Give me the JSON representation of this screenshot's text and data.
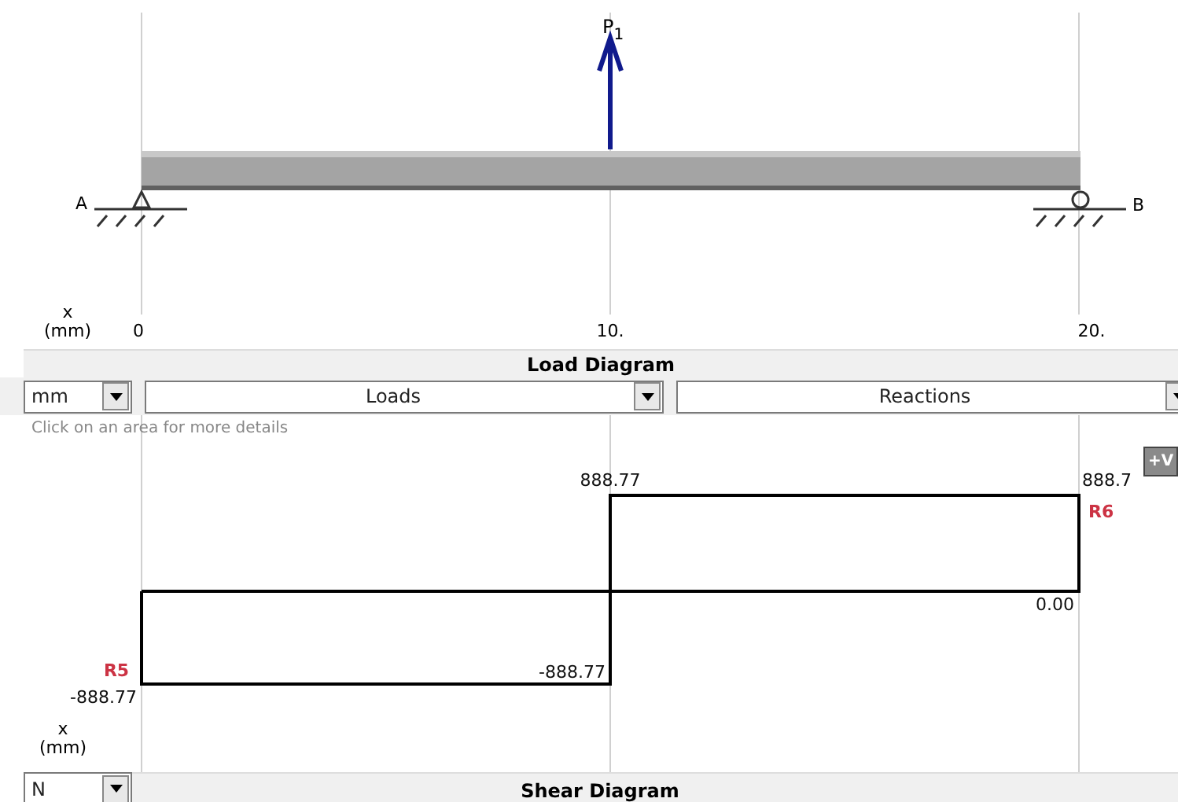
{
  "load_diagram": {
    "load_label": "P",
    "load_subscript": "1",
    "support_left": "A",
    "support_right": "B",
    "axis_unit": "(mm)",
    "axis_var": "x",
    "ticks": [
      "0",
      "10.",
      "20."
    ]
  },
  "load_header": {
    "title": "Load Diagram"
  },
  "toolbar": {
    "unit": "mm",
    "loads": "Loads",
    "reactions": "Reactions"
  },
  "shear_diagram": {
    "hint": "Click on an area for more details",
    "button": "+V",
    "axis_var": "x",
    "axis_unit": "(mm)",
    "labels": [
      {
        "text": "888.77",
        "kind": "value"
      },
      {
        "text": "888.7",
        "kind": "value"
      },
      {
        "text": "R6",
        "kind": "reaction",
        "color": "#cc3344"
      },
      {
        "text": "0.00",
        "kind": "value"
      },
      {
        "text": "R5",
        "kind": "reaction",
        "color": "#cc3344"
      },
      {
        "text": "-888.77",
        "kind": "value"
      },
      {
        "text": "-888.77",
        "kind": "value"
      }
    ]
  },
  "shear_footer": {
    "unit": "N",
    "title": "Shear Diagram"
  }
}
